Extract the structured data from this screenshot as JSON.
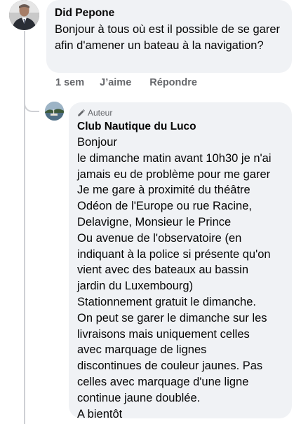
{
  "comment": {
    "author": "Did Pepone",
    "text": "Bonjour à tous où est il possible de se garer afin d'amener un bateau à la navigation?",
    "meta": {
      "time": "1 sem",
      "like_label": "J’aime",
      "reply_label": "Répondre"
    }
  },
  "reply": {
    "badge": "Auteur",
    "badge_icon": "pencil-icon",
    "author": "Club Nautique du Luco",
    "lines": [
      "Bonjour",
      "le dimanche matin avant 10h30 je n'ai",
      "jamais eu de problème pour me garer",
      "Je me gare à proximité du théâtre",
      "Odéon de l'Europe ou rue Racine,",
      "Delavigne, Monsieur le Prince",
      "Ou avenue de l'observatoire (en",
      "indiquant à la police si présente qu'on",
      "vient avec des bateaux au bassin",
      "jardin du Luxembourg)",
      "Stationnement gratuit le dimanche.",
      "On peut se garer le dimanche sur les",
      "livraisons mais uniquement celles",
      "avec marquage de lignes",
      "discontinues de couleur jaunes. Pas",
      "celles avec marquage d'une ligne",
      "continue jaune doublée.",
      "A bientôt"
    ]
  }
}
